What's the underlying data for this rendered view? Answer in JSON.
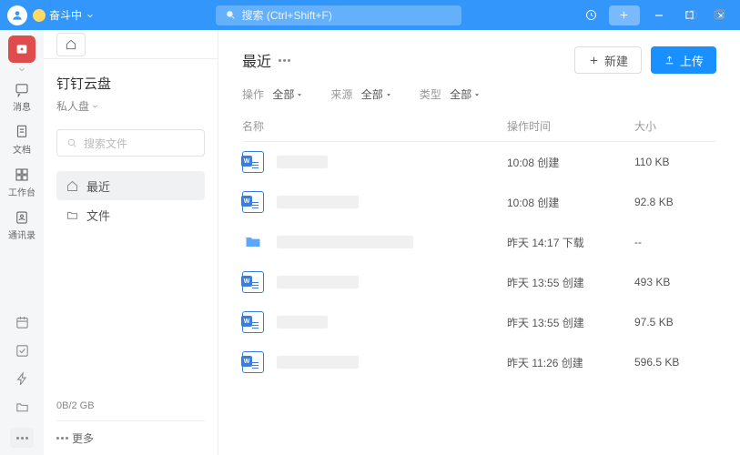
{
  "titlebar": {
    "status": "奋斗中",
    "search_placeholder": "搜索 (Ctrl+Shift+F)"
  },
  "nav": {
    "items": [
      {
        "label": "消息"
      },
      {
        "label": "文档"
      },
      {
        "label": "工作台"
      },
      {
        "label": "通讯录"
      }
    ]
  },
  "cloud": {
    "title": "钉钉云盘",
    "drive_selector": "私人盘",
    "search_placeholder": "搜索文件",
    "nav": {
      "recent": "最近",
      "files": "文件"
    },
    "storage": "0B/2 GB",
    "more": "更多"
  },
  "content": {
    "title": "最近",
    "new_button": "新建",
    "upload_button": "上传",
    "filters": {
      "op_label": "操作",
      "op_value": "全部",
      "source_label": "来源",
      "source_value": "全部",
      "type_label": "类型",
      "type_value": "全部"
    },
    "columns": {
      "name": "名称",
      "time": "操作时间",
      "size": "大小"
    },
    "rows": [
      {
        "kind": "word",
        "time": "10:08 创建",
        "size": "110 KB"
      },
      {
        "kind": "word",
        "time": "10:08 创建",
        "size": "92.8 KB"
      },
      {
        "kind": "folder",
        "time": "昨天 14:17 下载",
        "size": "--"
      },
      {
        "kind": "word",
        "time": "昨天 13:55 创建",
        "size": "493 KB"
      },
      {
        "kind": "word",
        "time": "昨天 13:55 创建",
        "size": "97.5 KB"
      },
      {
        "kind": "word",
        "time": "昨天 11:26 创建",
        "size": "596.5 KB"
      }
    ]
  }
}
